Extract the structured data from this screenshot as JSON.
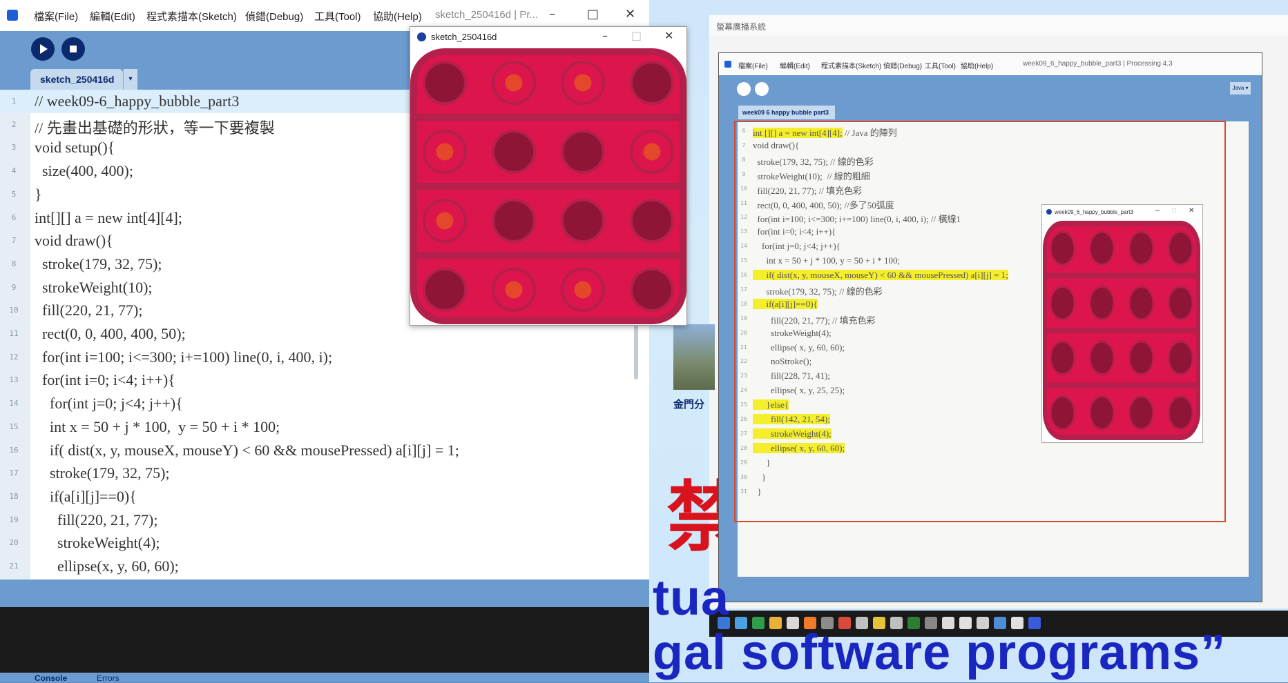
{
  "ide": {
    "menus": [
      "檔案(File)",
      "編輯(Edit)",
      "程式素描本(Sketch)",
      "偵錯(Debug)",
      "工具(Tool)",
      "協助(Help)"
    ],
    "window_title": "sketch_250416d | Pr...",
    "tab_label": "sketch_250416d",
    "tab_menu_glyph": "▾",
    "code_lines": [
      {
        "n": "1",
        "text": "// week09-6_happy_bubble_part3"
      },
      {
        "n": "2",
        "text": "// 先畫出基礎的形狀，等一下要複製"
      },
      {
        "n": "3",
        "text": "void setup(){"
      },
      {
        "n": "4",
        "text": "  size(400, 400);"
      },
      {
        "n": "5",
        "text": "}"
      },
      {
        "n": "6",
        "text": "int[][] a = new int[4][4];"
      },
      {
        "n": "7",
        "text": "void draw(){"
      },
      {
        "n": "8",
        "text": "  stroke(179, 32, 75);"
      },
      {
        "n": "9",
        "text": "  strokeWeight(10);"
      },
      {
        "n": "10",
        "text": "  fill(220, 21, 77);"
      },
      {
        "n": "11",
        "text": "  rect(0, 0, 400, 400, 50);"
      },
      {
        "n": "12",
        "text": "  for(int i=100; i<=300; i+=100) line(0, i, 400, i);"
      },
      {
        "n": "13",
        "text": "  for(int i=0; i<4; i++){"
      },
      {
        "n": "14",
        "text": "    for(int j=0; j<4; j++){"
      },
      {
        "n": "15",
        "text": "    int x = 50 + j * 100,  y = 50 + i * 100;"
      },
      {
        "n": "16",
        "text": "    if( dist(x, y, mouseX, mouseY) < 60 && mousePressed) a[i][j] = 1;"
      },
      {
        "n": "17",
        "text": "    stroke(179, 32, 75);"
      },
      {
        "n": "18",
        "text": "    if(a[i][j]==0){"
      },
      {
        "n": "19",
        "text": "      fill(220, 21, 77);"
      },
      {
        "n": "20",
        "text": "      strokeWeight(4);"
      },
      {
        "n": "21",
        "text": "      ellipse(x, y, 60, 60);"
      }
    ],
    "console_tabs": [
      "Console",
      "Errors"
    ]
  },
  "sketch_window": {
    "title": "sketch_250416d",
    "grid": [
      [
        0,
        1,
        1,
        0
      ],
      [
        1,
        0,
        0,
        1
      ],
      [
        1,
        0,
        0,
        0
      ],
      [
        0,
        1,
        1,
        0
      ]
    ]
  },
  "video": {
    "window_title": "螢幕廣播系統",
    "inner_menus": [
      "檔案(File)",
      "編輯(Edit)",
      "程式素描本(Sketch)",
      "偵錯(Debug)",
      "工具(Tool)",
      "協助(Help)"
    ],
    "inner_title": "week09_6_happy_bubble_part3 | Processing 4.3",
    "inner_tab": "week09 6 happy bubble part3",
    "inner_mode": "Java ▾",
    "inner_code": [
      {
        "n": "6",
        "text": "int [][] a = new int[4][4];",
        "note": " // Java 的陣列",
        "hl": true
      },
      {
        "n": "7",
        "text": "void draw(){",
        "note": "",
        "hl": false
      },
      {
        "n": "8",
        "text": "  stroke(179, 32, 75); // 線的色彩",
        "note": "",
        "hl": false
      },
      {
        "n": "9",
        "text": "  strokeWeight(10);  // 線的粗細",
        "note": "",
        "hl": false
      },
      {
        "n": "10",
        "text": "  fill(220, 21, 77); // 填充色彩",
        "note": "",
        "hl": false
      },
      {
        "n": "11",
        "text": "  rect(0, 0, 400, 400, 50); //多了50弧度",
        "note": "",
        "hl": false
      },
      {
        "n": "12",
        "text": "  for(int i=100; i<=300; i+=100) line(0, i, 400, i); // 橫線1",
        "note": "",
        "hl": false
      },
      {
        "n": "13",
        "text": "  for(int i=0; i<4; i++){",
        "note": "",
        "hl": false
      },
      {
        "n": "14",
        "text": "    for(int j=0; j<4; j++){",
        "note": "",
        "hl": false
      },
      {
        "n": "15",
        "text": "      int x = 50 + j * 100, y = 50 + i * 100;",
        "note": "",
        "hl": false
      },
      {
        "n": "16",
        "text": "      if( dist(x, y, mouseX, mouseY) < 60 && mousePressed) a[i][j] = 1;",
        "note": "",
        "hl": true
      },
      {
        "n": "17",
        "text": "      stroke(179, 32, 75); // 線的色彩",
        "note": "",
        "hl": false
      },
      {
        "n": "18",
        "text": "      if(a[i][j]==0){",
        "note": "",
        "hl": true
      },
      {
        "n": "19",
        "text": "        fill(220, 21, 77); // 填充色彩",
        "note": "",
        "hl": false
      },
      {
        "n": "20",
        "text": "        strokeWeight(4);",
        "note": "",
        "hl": false
      },
      {
        "n": "21",
        "text": "        ellipse( x, y, 60, 60);",
        "note": "",
        "hl": false
      },
      {
        "n": "22",
        "text": "        noStroke();",
        "note": "",
        "hl": false
      },
      {
        "n": "23",
        "text": "        fill(228, 71, 41);",
        "note": "",
        "hl": false
      },
      {
        "n": "24",
        "text": "        ellipse( x, y, 25, 25);",
        "note": "",
        "hl": false
      },
      {
        "n": "25",
        "text": "      }else{",
        "note": "",
        "hl": true
      },
      {
        "n": "26",
        "text": "        fill(142, 21, 54);",
        "note": "",
        "hl": true
      },
      {
        "n": "27",
        "text": "        strokeWeight(4);",
        "note": "",
        "hl": true
      },
      {
        "n": "28",
        "text": "        ellipse( x, y, 60, 60);",
        "note": "",
        "hl": true
      },
      {
        "n": "29",
        "text": "      }",
        "note": "",
        "hl": false
      },
      {
        "n": "30",
        "text": "    }",
        "note": "",
        "hl": false
      },
      {
        "n": "31",
        "text": "  }",
        "note": "",
        "hl": false
      }
    ],
    "mini_title": "week09_6_happy_bubble_part3",
    "subtitle_line1": "tua",
    "subtitle_line2": "gal software programs”",
    "side_headline": "金門分",
    "red_glyph": "禁"
  },
  "colors": {
    "bubble_base": "#dc154d",
    "bubble_stroke": "#b3204b",
    "bubble_pressed": "#8e1536",
    "bubble_dot": "#e44729"
  }
}
